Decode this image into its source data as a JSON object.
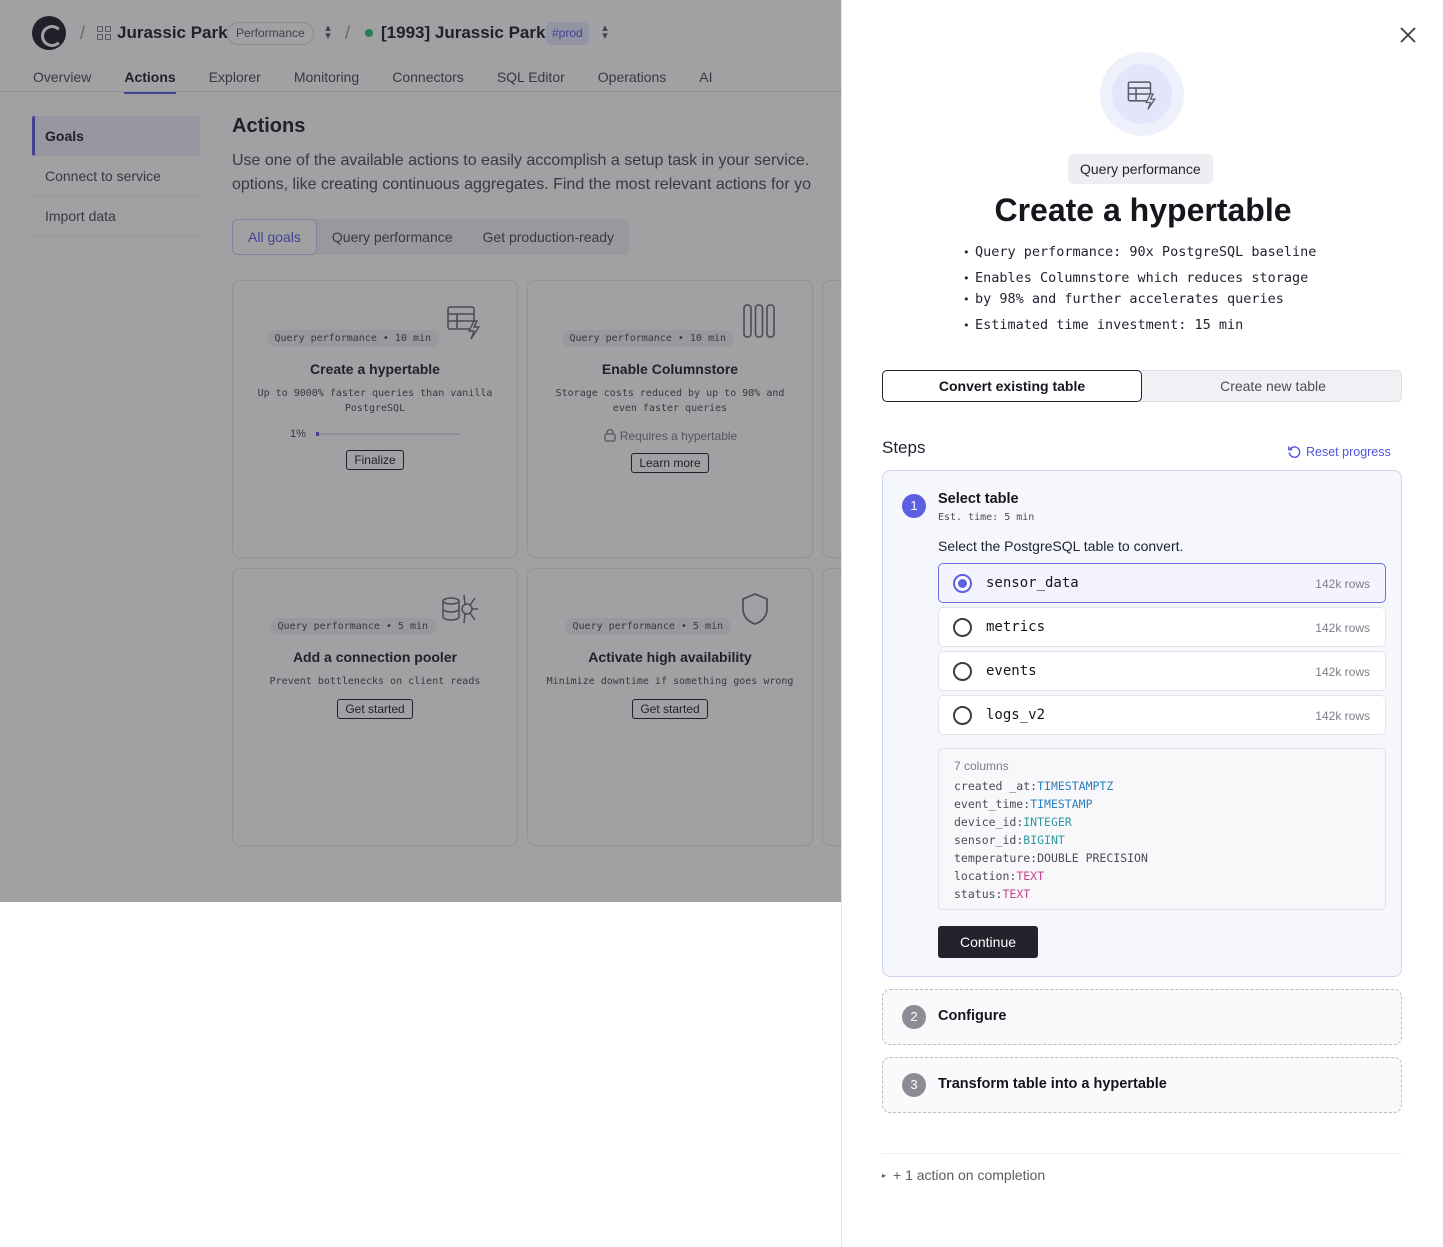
{
  "app": {
    "project_name": "Jurassic Park",
    "project_badge": "Performance",
    "service_name": "[1993] Jurassic Park",
    "service_tag": "#prod",
    "service_status_color": "#2fbf71",
    "accent_color": "#5b5fe0",
    "nav_tabs": [
      "Overview",
      "Actions",
      "Explorer",
      "Monitoring",
      "Connectors",
      "SQL Editor",
      "Operations",
      "AI"
    ],
    "active_tab": "Actions",
    "sidebar": [
      "Goals",
      "Connect to service",
      "Import data"
    ],
    "title": "Actions",
    "description_line1": "Use one of the available actions to easily accomplish a setup task in your service.",
    "description_line2": "options, like creating continuous aggregates. Find the most relevant actions for yo",
    "filters": [
      "All goals",
      "Query performance",
      "Get production-ready"
    ],
    "cards": [
      {
        "meta": "Query performance • 10 min",
        "icon": "hypertable-icon",
        "title": "Create a hypertable",
        "subtitle": "Up to 9000% faster queries than vanilla PostgreSQL",
        "progress_label": "1%",
        "progress": 0.01,
        "button": "Finalize"
      },
      {
        "meta": "Query performance • 10 min",
        "icon": "columnstore-icon",
        "title": "Enable Columnstore",
        "subtitle": "Storage costs reduced by up to 98% and even faster queries",
        "requirement": "Requires a hypertable",
        "button": "Learn more"
      },
      {
        "meta": "Query performance • 5 min",
        "icon": "connection-pooler-icon",
        "title": "Add a connection pooler",
        "subtitle": "Prevent bottlenecks on client reads",
        "button": "Get started"
      },
      {
        "meta": "Query performance • 5 min",
        "icon": "shield-icon",
        "title": "Activate high availability",
        "subtitle": "Minimize downtime if something goes wrong",
        "button": "Get started"
      }
    ]
  },
  "drawer": {
    "chip": "Query performance",
    "title": "Create a hypertable",
    "bullets": [
      "Query performance: 90x PostgreSQL baseline",
      "Enables Columnstore which reduces storage",
      "by 98% and further accelerates queries",
      "Estimated time investment: 15 min"
    ],
    "segments": [
      "Convert existing table",
      "Create new table"
    ],
    "steps_heading": "Steps",
    "reset_label": "Reset progress",
    "step1": {
      "number": "1",
      "title": "Select table",
      "est": "Est. time: 5 min",
      "instruction": "Select the PostgreSQL table to convert.",
      "tables": [
        {
          "name": "sensor_data",
          "rows": "142k rows",
          "selected": true
        },
        {
          "name": "metrics",
          "rows": "142k rows",
          "selected": false
        },
        {
          "name": "events",
          "rows": "142k rows",
          "selected": false
        },
        {
          "name": "logs_v2",
          "rows": "142k rows",
          "selected": false
        }
      ],
      "columns_header": "7 columns",
      "columns": [
        {
          "name": "created _at",
          "type": "TIMESTAMPTZ"
        },
        {
          "name": "event_time",
          "type": "TIMESTAMP"
        },
        {
          "name": "device_id",
          "type": "INTEGER"
        },
        {
          "name": "sensor_id",
          "type": "BIGINT"
        },
        {
          "name": "temperature",
          "type": "DOUBLE PRECISION"
        },
        {
          "name": "location",
          "type": "TEXT"
        },
        {
          "name": "status",
          "type": "TEXT"
        }
      ],
      "continue_label": "Continue"
    },
    "step2": {
      "number": "2",
      "title": "Configure"
    },
    "step3": {
      "number": "3",
      "title": "Transform table into a hypertable"
    },
    "footer": "+ 1 action on completion"
  }
}
